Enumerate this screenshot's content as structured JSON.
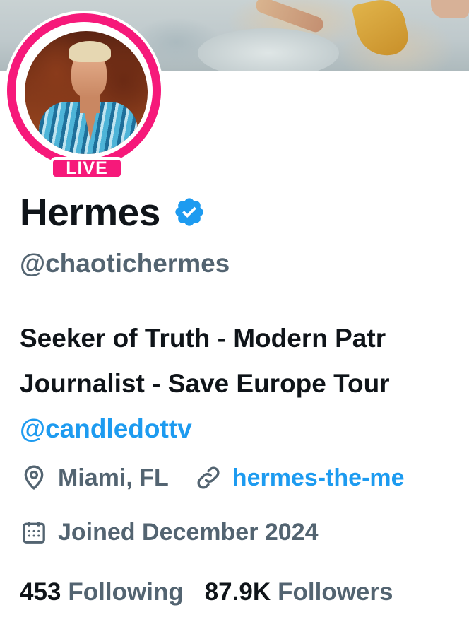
{
  "profile": {
    "display_name": "Hermes",
    "handle": "@chaotichermes",
    "live_label": "LIVE",
    "verified_icon": "verified-badge-icon"
  },
  "bio": {
    "line1": "Seeker of Truth - Modern Patr",
    "line2": "Journalist - Save Europe Tour",
    "mention": "@candledottv"
  },
  "meta": {
    "location": "Miami, FL",
    "website": "hermes-the-me",
    "joined": "Joined December 2024"
  },
  "stats": {
    "following_count": "453",
    "following_label": "Following",
    "followers_count": "87.9K",
    "followers_label": "Followers"
  },
  "colors": {
    "live_ring": "#f6197a",
    "accent": "#1d9bf0",
    "secondary_text": "#536471",
    "primary_text": "#0f1419"
  }
}
